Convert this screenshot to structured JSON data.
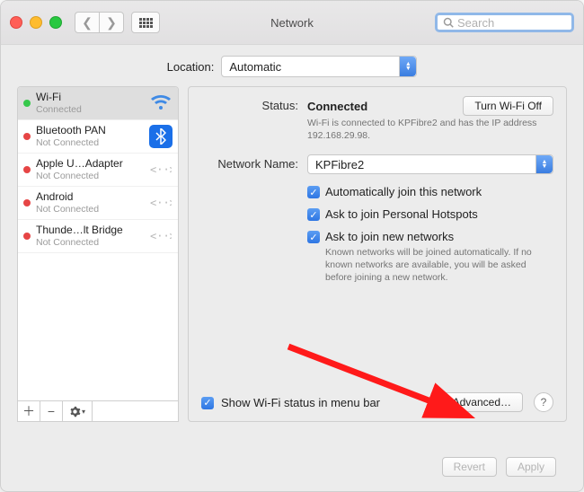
{
  "window": {
    "title": "Network"
  },
  "search": {
    "placeholder": "Search"
  },
  "location": {
    "label": "Location:",
    "value": "Automatic"
  },
  "sidebar": {
    "items": [
      {
        "name": "Wi-Fi",
        "sub": "Connected",
        "status": "green",
        "icon": "wifi",
        "selected": true
      },
      {
        "name": "Bluetooth PAN",
        "sub": "Not Connected",
        "status": "red",
        "icon": "bluetooth"
      },
      {
        "name": "Apple U…Adapter",
        "sub": "Not Connected",
        "status": "red",
        "icon": "link"
      },
      {
        "name": "Android",
        "sub": "Not Connected",
        "status": "red",
        "icon": "link"
      },
      {
        "name": "Thunde…lt Bridge",
        "sub": "Not Connected",
        "status": "red",
        "icon": "link"
      }
    ],
    "footer": {
      "add": "+",
      "remove": "−",
      "gear": "gear-icon"
    }
  },
  "details": {
    "status_label": "Status:",
    "status_value": "Connected",
    "turn_off": "Turn Wi-Fi Off",
    "status_hint": "Wi-Fi is connected to KPFibre2 and has the IP address 192.168.29.98.",
    "network_label": "Network Name:",
    "network_value": "KPFibre2",
    "auto_join": "Automatically join this network",
    "ask_hotspot": "Ask to join Personal Hotspots",
    "ask_new": "Ask to join new networks",
    "ask_new_hint": "Known networks will be joined automatically. If no known networks are available, you will be asked before joining a new network.",
    "show_menu": "Show Wi-Fi status in menu bar",
    "advanced": "Advanced…"
  },
  "footer": {
    "revert": "Revert",
    "apply": "Apply"
  }
}
